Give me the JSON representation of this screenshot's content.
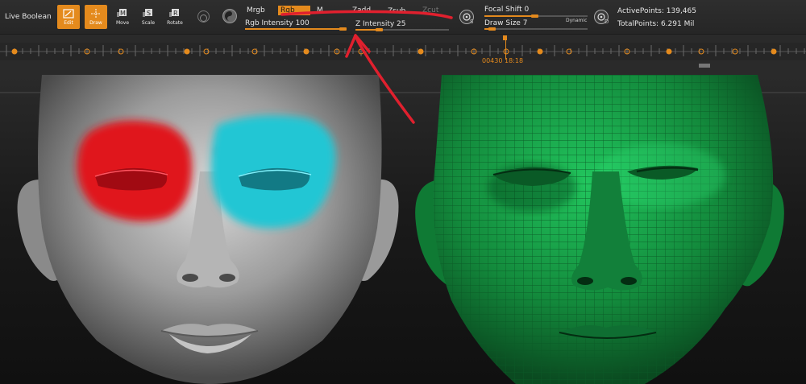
{
  "toolbar": {
    "live_boolean": "Live Boolean",
    "tools": [
      {
        "label": "Edit",
        "icon": "edit-icon",
        "active": true
      },
      {
        "label": "Draw",
        "icon": "draw-icon",
        "active": true
      },
      {
        "label": "Move",
        "icon": "move-icon",
        "active": false
      },
      {
        "label": "Scale",
        "icon": "scale-icon",
        "active": false
      },
      {
        "label": "Rotate",
        "icon": "rotate-icon",
        "active": false
      }
    ],
    "mrgb": "Mrgb",
    "rgb": "Rgb",
    "m": "M",
    "zadd": "Zadd",
    "zsub": "Zsub",
    "zcut": "Zcut",
    "rgb_intensity": "Rgb Intensity 100",
    "z_intensity": "Z Intensity 25",
    "focal_shift": "Focal Shift 0",
    "draw_size": "Draw Size 7",
    "dynamic": "Dynamic",
    "active_points": "ActivePoints: 139,465",
    "total_points": "TotalPoints: 6.291 Mil",
    "s_icon_letter": "S",
    "d_icon_letter": "D"
  },
  "timeline": {
    "time_readout": "00430 18:18"
  },
  "colors": {
    "accent": "#e48a1d",
    "red_paint": "#e0141e",
    "cyan_paint": "#22c6d4",
    "polypaint_green": "#17a04a",
    "annotation_red": "#e0202e"
  }
}
